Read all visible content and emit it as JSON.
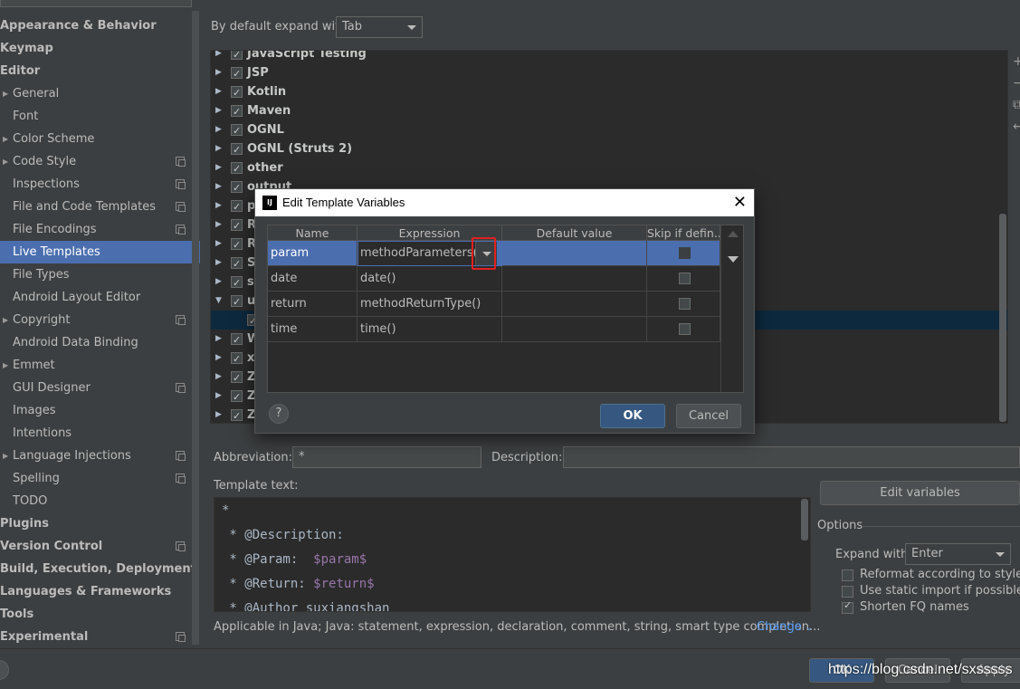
{
  "sidebar": {
    "items": [
      {
        "label": "Appearance & Behavior",
        "level": 0
      },
      {
        "label": "Keymap",
        "level": 0
      },
      {
        "label": "Editor",
        "level": 0
      },
      {
        "label": "General",
        "level": 1,
        "arrow": true
      },
      {
        "label": "Font",
        "level": 1
      },
      {
        "label": "Color Scheme",
        "level": 1,
        "arrow": true
      },
      {
        "label": "Code Style",
        "level": 1,
        "arrow": true,
        "copy": true
      },
      {
        "label": "Inspections",
        "level": 1,
        "copy": true
      },
      {
        "label": "File and Code Templates",
        "level": 1,
        "copy": true
      },
      {
        "label": "File Encodings",
        "level": 1,
        "copy": true
      },
      {
        "label": "Live Templates",
        "level": 1,
        "selected": true
      },
      {
        "label": "File Types",
        "level": 1
      },
      {
        "label": "Android Layout Editor",
        "level": 1
      },
      {
        "label": "Copyright",
        "level": 1,
        "arrow": true,
        "copy": true
      },
      {
        "label": "Android Data Binding",
        "level": 1
      },
      {
        "label": "Emmet",
        "level": 1,
        "arrow": true
      },
      {
        "label": "GUI Designer",
        "level": 1,
        "copy": true
      },
      {
        "label": "Images",
        "level": 1
      },
      {
        "label": "Intentions",
        "level": 1
      },
      {
        "label": "Language Injections",
        "level": 1,
        "arrow": true,
        "copy": true
      },
      {
        "label": "Spelling",
        "level": 1,
        "copy": true
      },
      {
        "label": "TODO",
        "level": 1
      },
      {
        "label": "Plugins",
        "level": 0
      },
      {
        "label": "Version Control",
        "level": 0,
        "copy": true
      },
      {
        "label": "Build, Execution, Deployment",
        "level": 0
      },
      {
        "label": "Languages & Frameworks",
        "level": 0
      },
      {
        "label": "Tools",
        "level": 0
      },
      {
        "label": "Experimental",
        "level": 0,
        "copy": true
      }
    ]
  },
  "header": {
    "expand_label": "By default expand with",
    "expand_value": "Tab"
  },
  "tree": {
    "rows": [
      {
        "label": "JavaScript Testing",
        "expanded": false
      },
      {
        "label": "JSP",
        "expanded": false
      },
      {
        "label": "Kotlin",
        "expanded": false
      },
      {
        "label": "Maven",
        "expanded": false
      },
      {
        "label": "OGNL",
        "expanded": false
      },
      {
        "label": "OGNL (Struts 2)",
        "expanded": false
      },
      {
        "label": "other",
        "expanded": false
      },
      {
        "label": "output",
        "expanded": false
      },
      {
        "label": "p",
        "expanded": false
      },
      {
        "label": "R",
        "expanded": false
      },
      {
        "label": "R",
        "expanded": false
      },
      {
        "label": "S",
        "expanded": false
      },
      {
        "label": "su",
        "expanded": false
      },
      {
        "label": "us",
        "expanded": true
      },
      {
        "label": "",
        "expanded": false,
        "child": true,
        "selected": true
      },
      {
        "label": "W",
        "expanded": false
      },
      {
        "label": "xs",
        "expanded": false
      },
      {
        "label": "Ze",
        "expanded": false
      },
      {
        "label": "Ze",
        "expanded": false
      },
      {
        "label": "Ze",
        "expanded": false
      }
    ],
    "side_tools": [
      "+",
      "−",
      "⧉",
      "↩"
    ]
  },
  "abbreviation": {
    "label": "Abbreviation:",
    "value": "*"
  },
  "description": {
    "label": "Description:",
    "value": ""
  },
  "template_text": {
    "label": "Template text:",
    "lines": [
      {
        "text": "*",
        "var": ""
      },
      {
        "text": " * @Description:",
        "var": ""
      },
      {
        "text": " * @Param:  ",
        "var": "$param$"
      },
      {
        "text": " * @Return: ",
        "var": "$return$"
      },
      {
        "text": " * @Author suxiangshan",
        "var": ""
      }
    ]
  },
  "edit_variables_button": "Edit variables",
  "options": {
    "title": "Options",
    "expand_with_label": "Expand with",
    "expand_with_value": "Enter",
    "checkboxes": [
      {
        "label": "Reformat according to style",
        "checked": false
      },
      {
        "label": "Use static import if possible",
        "checked": false
      },
      {
        "label": "Shorten FQ names",
        "checked": true
      }
    ]
  },
  "applicable": {
    "text": "Applicable in Java; Java: statement, expression, declaration, comment, string, smart type completion...",
    "change_link": "Change"
  },
  "bottom": {
    "ok": "OK",
    "cancel": "Cancel",
    "apply": "Apply",
    "watermark": "https://blog.csdn.net/sxsssss"
  },
  "dialog": {
    "title": "Edit Template Variables",
    "app_icon": "IJ",
    "columns": [
      "Name",
      "Expression",
      "Default value",
      "Skip if defin..."
    ],
    "rows": [
      {
        "name": "param",
        "expression": "methodParameters()",
        "default": "",
        "skip": false,
        "selected": true
      },
      {
        "name": "date",
        "expression": "date()",
        "default": "",
        "skip": false
      },
      {
        "name": "return",
        "expression": "methodReturnType()",
        "default": "",
        "skip": false
      },
      {
        "name": "time",
        "expression": "time()",
        "default": "",
        "skip": false
      }
    ],
    "ok": "OK",
    "cancel": "Cancel",
    "help": "?"
  },
  "colors": {
    "background": "#3c3f41",
    "selection": "#4b6eaf",
    "editor_bg": "#2b2b2b",
    "highlight_red": "#e02020",
    "template_var": "#9876aa"
  }
}
